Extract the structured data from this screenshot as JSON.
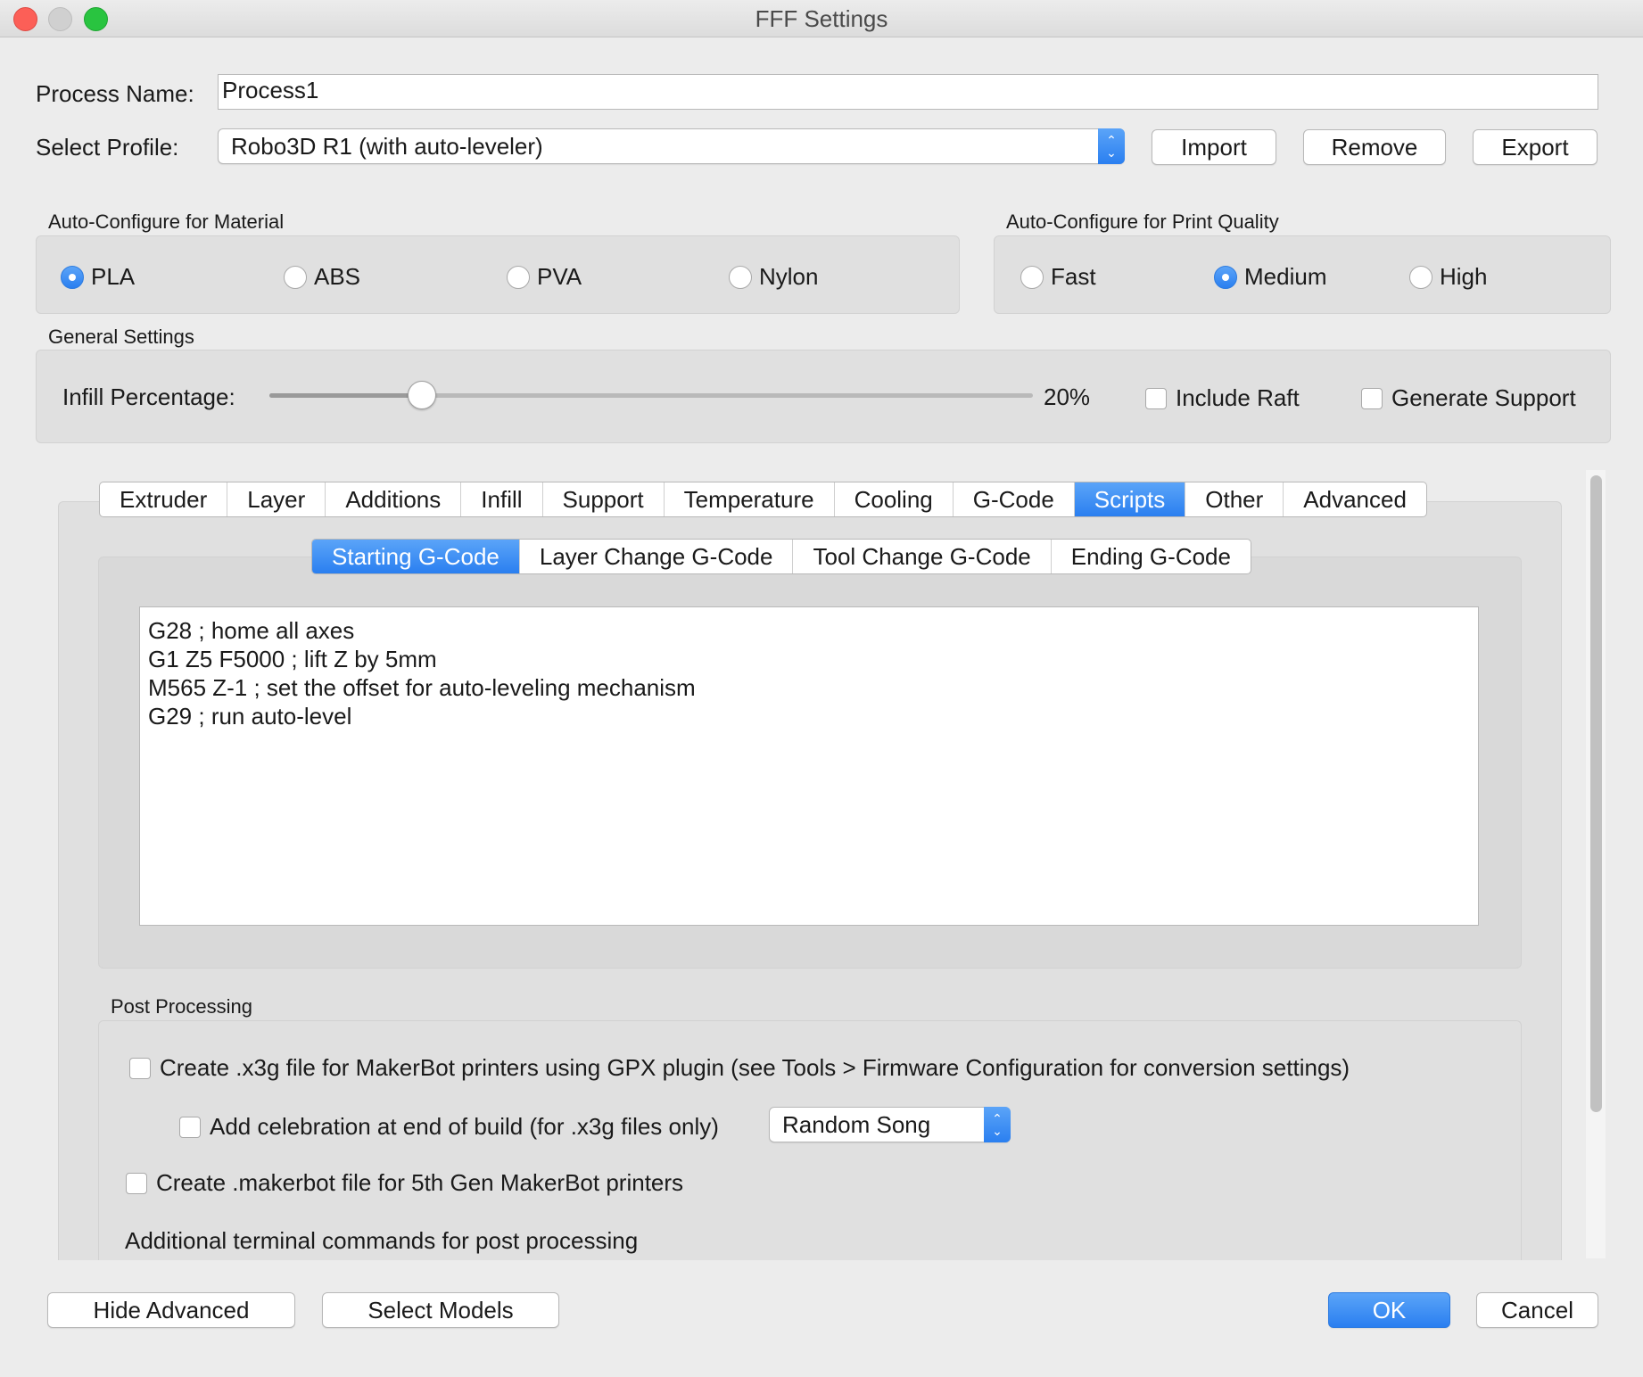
{
  "window": {
    "title": "FFF Settings"
  },
  "process": {
    "label": "Process Name:",
    "value": "Process1"
  },
  "profile": {
    "label": "Select Profile:",
    "value": "Robo3D R1 (with auto-leveler)",
    "import": "Import",
    "remove": "Remove",
    "export": "Export"
  },
  "material": {
    "title": "Auto-Configure for Material",
    "options": [
      "PLA",
      "ABS",
      "PVA",
      "Nylon"
    ],
    "selected": "PLA"
  },
  "quality": {
    "title": "Auto-Configure for Print Quality",
    "options": [
      "Fast",
      "Medium",
      "High"
    ],
    "selected": "Medium"
  },
  "general": {
    "title": "General Settings",
    "infill_label": "Infill Percentage:",
    "infill_value": "20%",
    "infill_fraction": 0.2,
    "include_raft": "Include Raft",
    "generate_support": "Generate Support"
  },
  "tabs": {
    "items": [
      "Extruder",
      "Layer",
      "Additions",
      "Infill",
      "Support",
      "Temperature",
      "Cooling",
      "G-Code",
      "Scripts",
      "Other",
      "Advanced"
    ],
    "active": "Scripts"
  },
  "subtabs": {
    "items": [
      "Starting G-Code",
      "Layer Change G-Code",
      "Tool Change G-Code",
      "Ending G-Code"
    ],
    "active": "Starting G-Code"
  },
  "gcode": {
    "lines": [
      "G28 ; home all axes",
      "G1 Z5 F5000 ; lift Z by 5mm",
      "M565 Z-1 ; set the offset for auto-leveling mechanism",
      "G29 ; run auto-level"
    ]
  },
  "post": {
    "title": "Post Processing",
    "x3g": "Create .x3g file for MakerBot printers using GPX plugin (see Tools > Firmware Configuration for conversion settings)",
    "celebration": "Add celebration at end of build (for .x3g files only)",
    "song": "Random Song",
    "makerbot": "Create .makerbot file for 5th Gen MakerBot printers",
    "terminal": "Additional terminal commands for post processing"
  },
  "footer": {
    "hide_advanced": "Hide Advanced",
    "select_models": "Select Models",
    "ok": "OK",
    "cancel": "Cancel"
  },
  "colors": {
    "accent": "#2a7ff0",
    "close": "#fc5f57",
    "minimize": "#d0d0d0",
    "zoom": "#29c440"
  }
}
